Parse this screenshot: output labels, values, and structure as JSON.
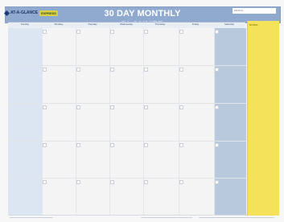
{
  "planner": {
    "brand": "AT-A-GLANCE",
    "brand_badge": "EXPRESS",
    "title": "30 DAY MONTHLY PLANNER",
    "month_field": "MONTH",
    "days": [
      "Sunday",
      "Monday",
      "Tuesday",
      "Wednesday",
      "Thursday",
      "Friday",
      "Saturday"
    ],
    "notes_title": "NOTES"
  }
}
